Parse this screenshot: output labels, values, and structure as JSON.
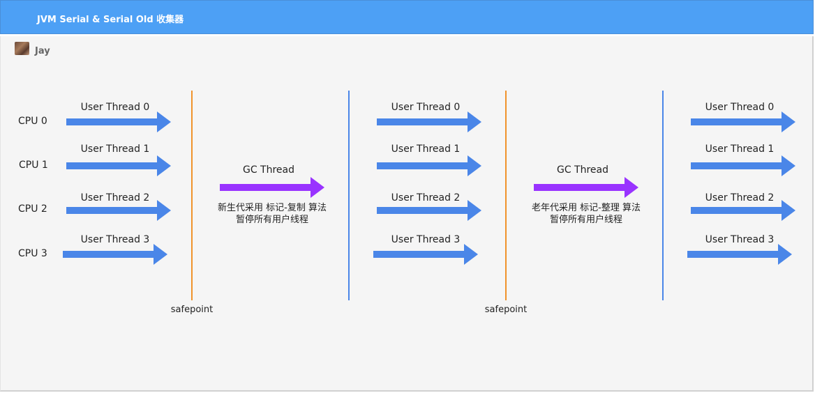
{
  "header": {
    "title": "JVM Serial & Serial Old 收集器"
  },
  "author": {
    "name": "Jay"
  },
  "cpus": [
    "CPU 0",
    "CPU 1",
    "CPU 2",
    "CPU 3"
  ],
  "threads": [
    "User Thread 0",
    "User Thread 1",
    "User Thread 2",
    "User Thread 3"
  ],
  "gc_young": {
    "label": "GC Thread",
    "line1": "新生代采用 标记-复制 算法",
    "line2": "暂停所有用户线程"
  },
  "gc_old": {
    "label": "GC Thread",
    "line1": "老年代采用 标记-整理 算法",
    "line2": "暂停所有用户线程"
  },
  "safepoint_label": "safepoint",
  "colors": {
    "header": "#4da0f5",
    "user_arrow": "#4a86e8",
    "gc_arrow": "#9933ff",
    "safepoint_line": "#f0932b",
    "end_line": "#4a86e8",
    "canvas": "#f5f5f5"
  },
  "icons": {
    "avatar": "user-avatar-photo"
  }
}
